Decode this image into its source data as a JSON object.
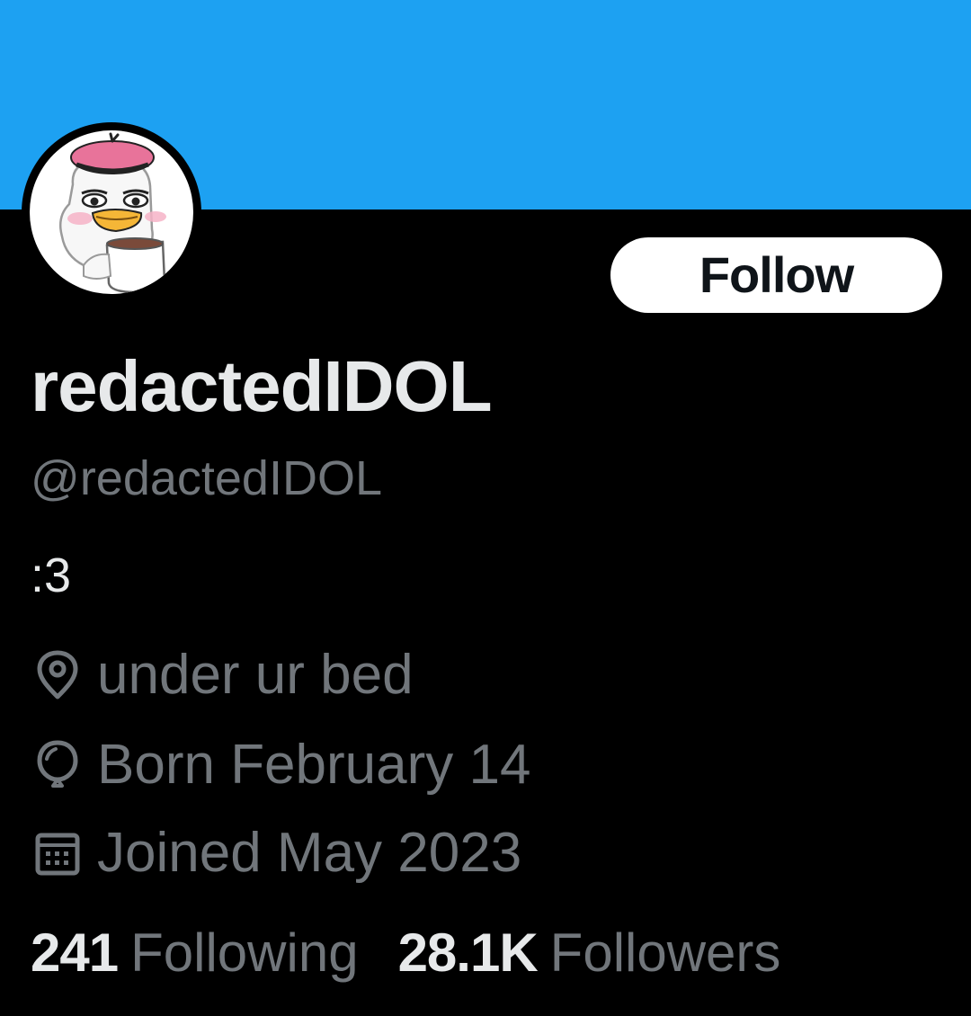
{
  "colors": {
    "banner": "#1DA1F2",
    "background": "#000000",
    "primary_text": "#E7E9EA",
    "secondary_text": "#71767B",
    "button_bg": "#FFFFFF",
    "button_text": "#0F1419"
  },
  "profile": {
    "display_name": "redactedIDOL",
    "handle": "@redactedIDOL",
    "bio": ":3",
    "avatar_icon": "duck-with-pink-beret-avatar"
  },
  "actions": {
    "follow_label": "Follow"
  },
  "meta": {
    "location": {
      "icon": "location-pin-icon",
      "text": "under ur bed"
    },
    "birthday": {
      "icon": "balloon-icon",
      "text": "Born February 14"
    },
    "joined": {
      "icon": "calendar-icon",
      "text": "Joined May 2023"
    }
  },
  "stats": {
    "following_count": "241",
    "following_label": "Following",
    "followers_count": "28.1K",
    "followers_label": "Followers"
  }
}
